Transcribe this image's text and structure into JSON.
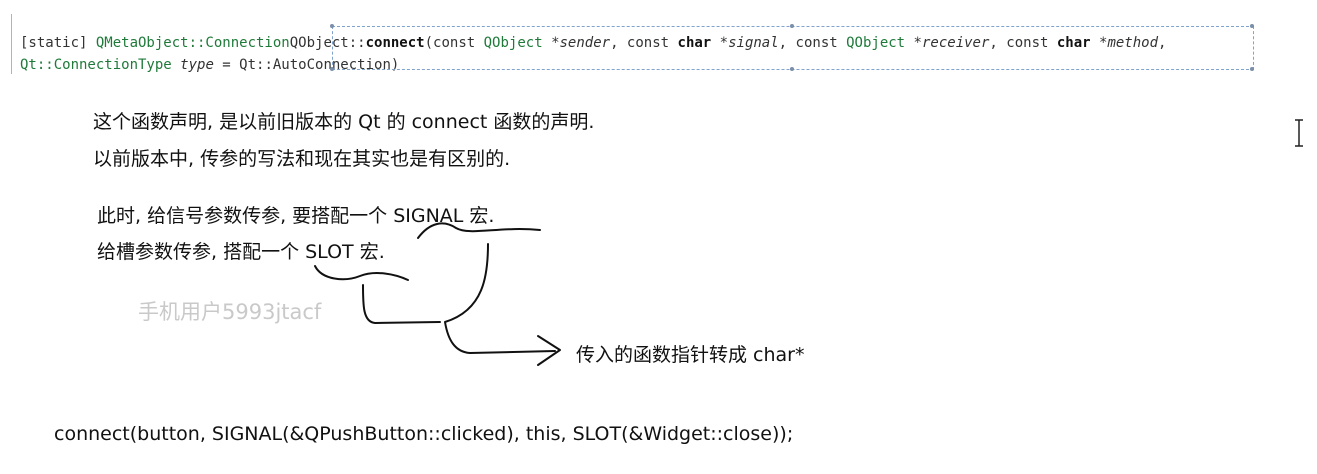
{
  "signature": {
    "line1": {
      "static_tag": "[static] ",
      "return_type": "QMetaObject::Connection",
      "class_name": "QObject::",
      "function_name": "connect",
      "open": "(const ",
      "p1_type": "QObject",
      "p1_star": " *",
      "p1_name": "sender",
      "sep1": ", const ",
      "p2_type": "char",
      "p2_star": " *",
      "p2_name": "signal",
      "sep2": ", const ",
      "p3_type": "QObject",
      "p3_star": " *",
      "p3_name": "receiver",
      "sep3": ", const ",
      "p4_type": "char",
      "p4_star": " *",
      "p4_name": "method",
      "trail": ","
    },
    "line2": {
      "p5_type": "Qt::ConnectionType",
      "p5_name": "type",
      "default": " = Qt::AutoConnection)"
    }
  },
  "notes": {
    "line1": "这个函数声明, 是以前旧版本的 Qt 的 connect 函数的声明.",
    "line2": "以前版本中, 传参的写法和现在其实也是有区别的.",
    "line3": "此时, 给信号参数传参, 要搭配一个 SIGNAL 宏.",
    "line4": "给槽参数传参, 搭配一个 SLOT 宏.",
    "annotation": "传入的函数指针转成 char*"
  },
  "watermark": "手机用户5993jtacf",
  "code_example": "connect(button, SIGNAL(&QPushButton::clicked), this, SLOT(&Widget::close));",
  "icons": {
    "cursor": "text-ibeam-cursor-icon"
  },
  "colors": {
    "keyword": "#1f7a3a",
    "selection": "#7fa3cc",
    "ink": "#111111"
  }
}
